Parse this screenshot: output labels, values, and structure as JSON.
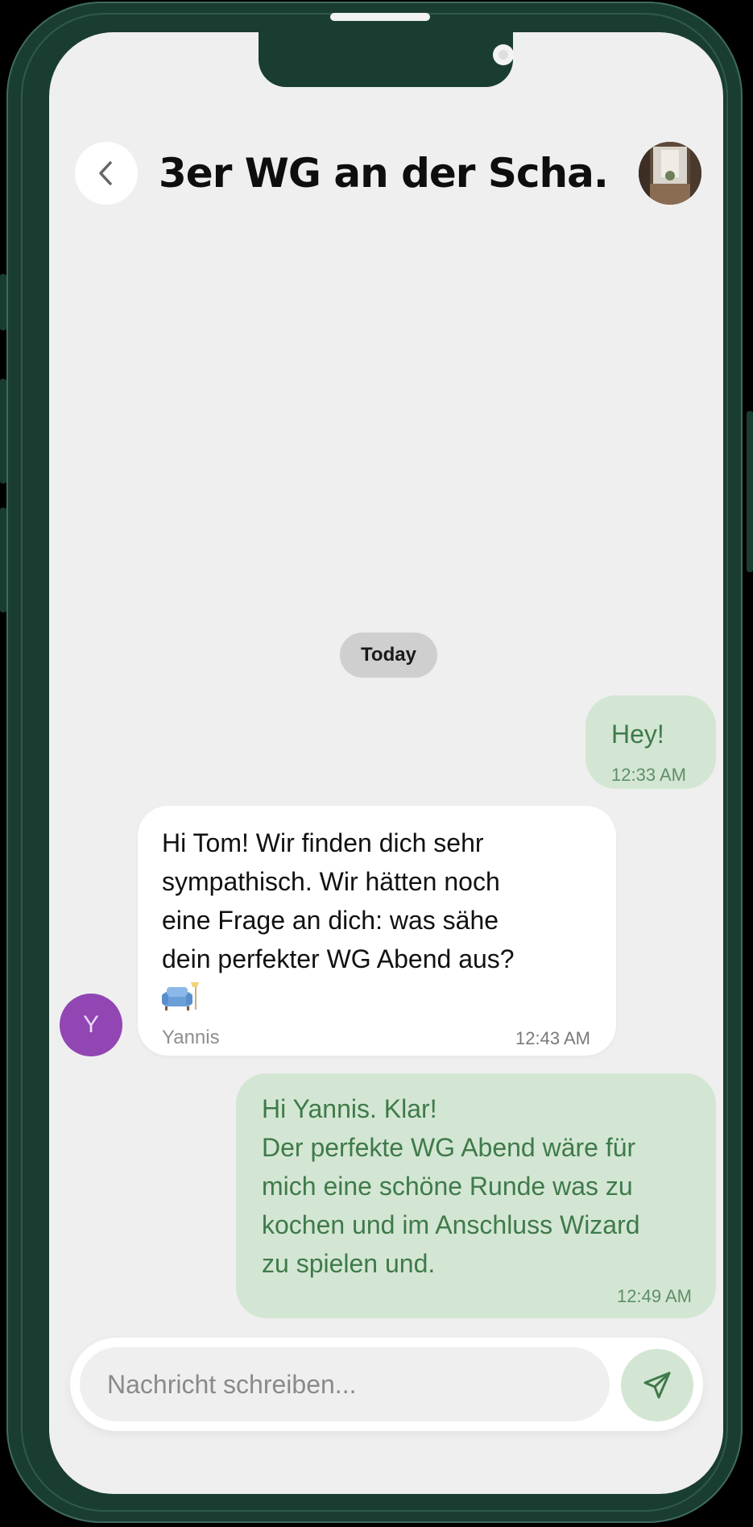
{
  "header": {
    "title": "3er WG an der Scha..."
  },
  "date_separator": "Today",
  "messages": [
    {
      "text": "Hey!",
      "time": "12:33 AM"
    },
    {
      "text": "Hi Tom! Wir finden dich sehr\nsympathisch. Wir hätten noch\neine Frage an dich: was sähe\ndein perfekter WG Abend aus?",
      "emoji": "couch-icon",
      "sender": "Yannis",
      "avatar_initial": "Y",
      "time": "12:43 AM"
    },
    {
      "text": "Hi Yannis. Klar!\nDer perfekte WG Abend wäre für\nmich eine schöne Runde was zu\nkochen und im Anschluss Wizard\nzu spielen und.",
      "time": "12:49 AM"
    }
  ],
  "composer": {
    "placeholder": "Nachricht schreiben..."
  },
  "colors": {
    "frame": "#1a3d31",
    "screen_bg": "#efefef",
    "outgoing_bubble": "#d3e6d3",
    "outgoing_text": "#3f7a4a",
    "avatar_purple": "#9146b4"
  }
}
